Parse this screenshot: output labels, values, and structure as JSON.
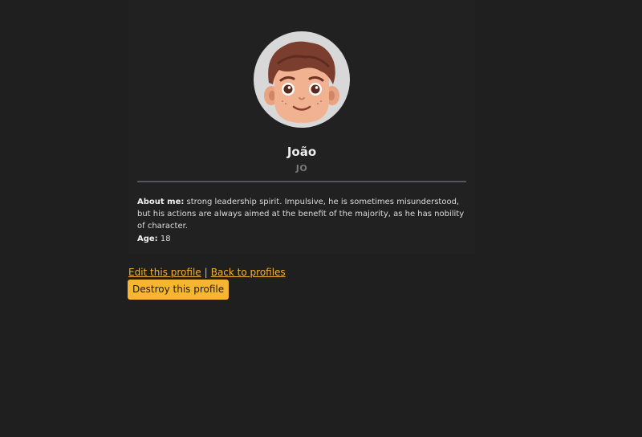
{
  "profile": {
    "name": "João",
    "initials": "JO",
    "about_label": "About me:",
    "about_text": "strong leadership spirit. Impulsive, he is sometimes misunderstood, but his actions are always aimed at the benefit of the majority, as he has nobility of character.",
    "age_label": "Age:",
    "age_value": "18",
    "avatar_icon": "cartoon-boy-avatar"
  },
  "actions": {
    "edit_label": "Edit this profile",
    "separator": "|",
    "back_label": "Back to profiles",
    "destroy_label": "Destroy this profile"
  },
  "colors": {
    "background": "#1f1f1f",
    "accent": "#f8b531",
    "link": "#f3b233",
    "divider": "#55555c",
    "avatar_bg": "#d8d8d8"
  }
}
